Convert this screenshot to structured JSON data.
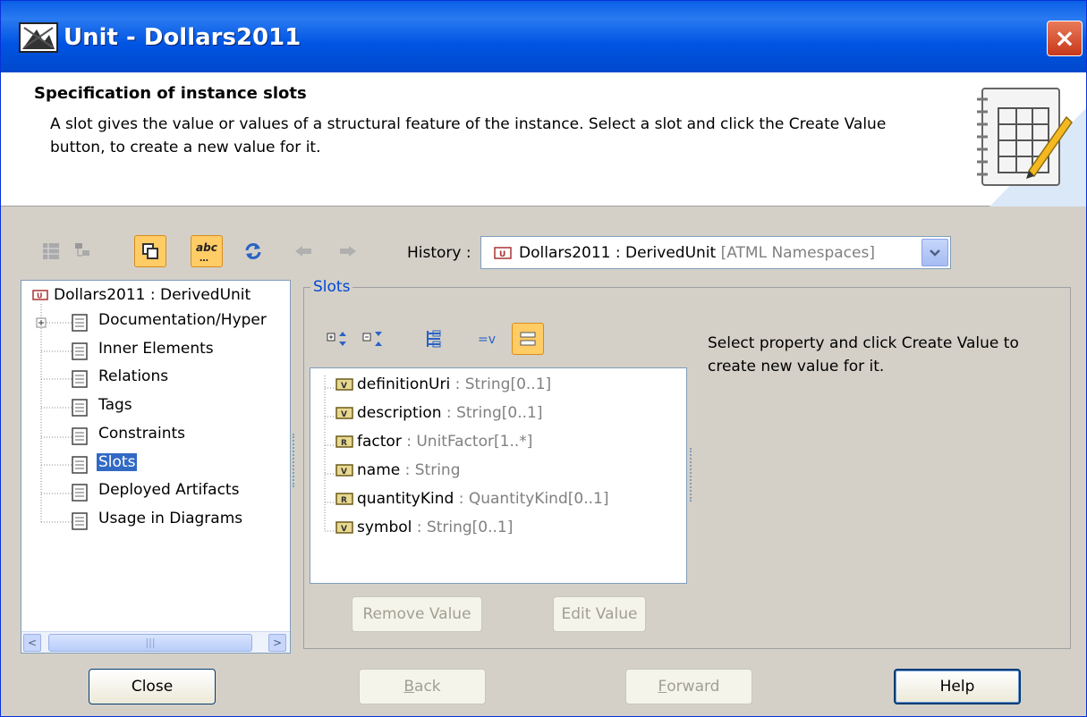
{
  "window": {
    "title": "Unit - Dollars2011",
    "close_glyph": "×"
  },
  "header": {
    "title": "Specification of instance slots",
    "description": "A slot gives the value or values of a structural feature of the instance. Select a slot and click the Create Value button, to create a new value for it."
  },
  "toolbar": {
    "history_label": "History :",
    "history_value": "Dollars2011 : DerivedUnit",
    "history_context": "[ATML Namespaces]",
    "buttons": [
      "table-view-icon",
      "tree-view-icon",
      "copy-icon",
      "abc-icon",
      "refresh-icon",
      "back-arrow-icon",
      "forward-arrow-icon"
    ]
  },
  "tree": {
    "root": "Dollars2011 : DerivedUnit",
    "items": [
      {
        "label": "Documentation/Hyper",
        "expandable": true
      },
      {
        "label": "Inner Elements"
      },
      {
        "label": "Relations"
      },
      {
        "label": "Tags"
      },
      {
        "label": "Constraints"
      },
      {
        "label": "Slots",
        "selected": true
      },
      {
        "label": "Deployed Artifacts"
      },
      {
        "label": "Usage in Diagrams"
      }
    ]
  },
  "slots": {
    "group_title": "Slots",
    "info": "Select property and click Create Value to create new value for it.",
    "rows": [
      {
        "name": "definitionUri",
        "type": " : String[0..1]",
        "kind": "value"
      },
      {
        "name": "description",
        "type": " : String[0..1]",
        "kind": "value"
      },
      {
        "name": "factor",
        "type": " : UnitFactor[1..*]",
        "kind": "reference"
      },
      {
        "name": "name",
        "type": " : String",
        "kind": "value"
      },
      {
        "name": "quantityKind",
        "type": " : QuantityKind[0..1]",
        "kind": "reference"
      },
      {
        "name": "symbol",
        "type": " : String[0..1]",
        "kind": "value"
      }
    ],
    "remove_value": "Remove Value",
    "edit_value": "Edit Value"
  },
  "footer": {
    "close": "Close",
    "back": "Back",
    "forward": "Forward",
    "help": "Help"
  },
  "colors": {
    "title_bar": "#0054e3",
    "selection": "#316ac5",
    "active_toggle": "#ffcc66"
  }
}
